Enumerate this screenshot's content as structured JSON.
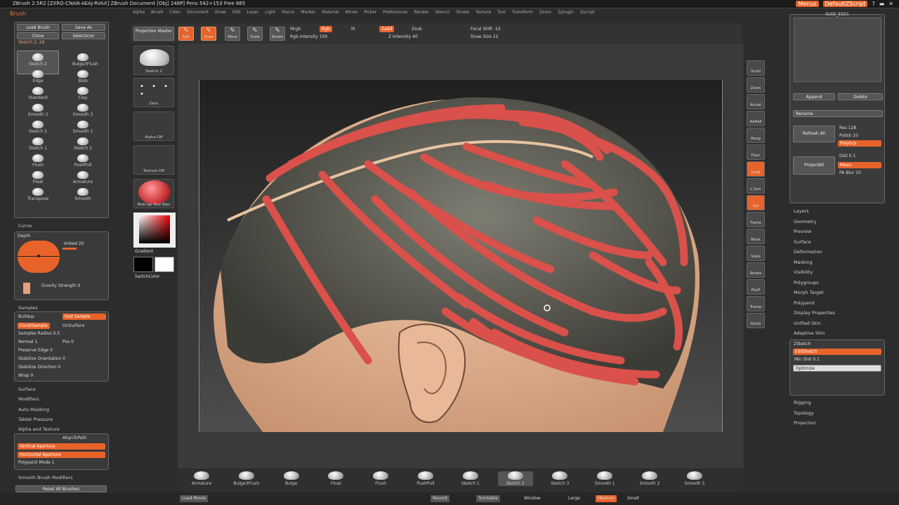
{
  "app": {
    "title": "ZBrush 2.5R2 [ZXRO-CNAN-AEAJ-RVAX]    ZBrush Document    [Obj] 248P] Pens 542+153 Free 885",
    "menus": [
      "Alpha",
      "Brush",
      "Color",
      "Document",
      "Draw",
      "Edit",
      "Layer",
      "Light",
      "Macro",
      "Marker",
      "Material",
      "Movie",
      "Picker",
      "Preferences",
      "Render",
      "Stencil",
      "Stroke",
      "Texture",
      "Tool",
      "Transform",
      "Zoom",
      "Zplugin",
      "Zscript"
    ],
    "menu_highlight": "Menus",
    "default_script": "DefaultZScript",
    "accent": "#e8632a"
  },
  "left": {
    "brush_title": "Brush",
    "load_brush": "Load Brush",
    "save_as": "Save As",
    "clone": "Clone",
    "selection": "SelectIcon",
    "sketch_label": "Sketch 2: 28",
    "brushes": [
      {
        "label": "Sketch 2"
      },
      {
        "label": "Bulge3Flush"
      },
      {
        "label": "Edge"
      },
      {
        "label": "Blob"
      },
      {
        "label": "Standard"
      },
      {
        "label": "Clay"
      },
      {
        "label": "Smooth 2"
      },
      {
        "label": "Smooth 3"
      },
      {
        "label": "Sketch 2"
      },
      {
        "label": "Smooth 1"
      },
      {
        "label": "Sketch 1"
      },
      {
        "label": "Sketch 2"
      },
      {
        "label": "Flush"
      },
      {
        "label": "PushPull"
      },
      {
        "label": "Float"
      },
      {
        "label": "Armature"
      },
      {
        "label": "Transpose"
      },
      {
        "label": "Smooth"
      }
    ],
    "curve": "Curve",
    "depth": "Depth",
    "imbed": "Imbed 20",
    "gravity": "Gravity Strength 0",
    "samples": "Samples",
    "buildup": "Buildup",
    "fast_sample": "Fast Sample",
    "const_sample": "ConstSample",
    "on_surface": "OnSurface",
    "samples_radius": "Samples Radius 0.5",
    "normal": "Normal 1",
    "pos": "Pos 0",
    "preserve_edge": "Preserve Edge 0",
    "stabilize_orientation": "Stabilize Orientation 0",
    "stabilize_direction": "Stabilize Direction 0",
    "wrap": "Wrap 0",
    "surface": "Surface",
    "modifiers": "Modifiers",
    "auto_masking": "Auto Masking",
    "tablet_pressure": "Tablet Pressure",
    "alpha_texture": "Alpha and Texture",
    "align_to_path": "AlignToPath",
    "vertical_aperture": "Vertical Aperture",
    "horizontal_aperture": "Horizontal Aperture",
    "polypaint_mode": "Polypaint Mode 1",
    "smooth_modifiers": "Smooth Brush Modifiers",
    "reset_brushes": "Reset All Brushes"
  },
  "shelf": {
    "projection_master": "Projection Master",
    "tools": [
      "Edit",
      "Draw",
      "Move",
      "Scale",
      "Rotate"
    ],
    "mrgb": "Mrgb",
    "rgb": "Rgb",
    "m": "M",
    "zadd": "Zadd",
    "zsub": "Zsub",
    "rgb_intensity": "Rgb Intensity 100",
    "z_intensity": "Z Intensity 40",
    "focal_shift": "Focal Shift -15",
    "draw_size": "Draw Size 22"
  },
  "tray": {
    "items": [
      "Sketch 2",
      "Dots",
      "Alpha Off",
      "Texture Off",
      "MatCap Red Wax"
    ],
    "gradient": "Gradient",
    "switch_color": "SwitchColor"
  },
  "right_tools": [
    "Scroll",
    "Zoom",
    "Actual",
    "AAHalf",
    "Persp",
    "Floor",
    "Local",
    "L.Sym",
    "Xyz",
    "Frame",
    "Move",
    "Scale",
    "Rotate",
    "PolyF",
    "Transp",
    "Ghost"
  ],
  "right": {
    "subtool_name": "GUIO_ES01",
    "append": "Append",
    "delete": "Delete",
    "rename": "Rename",
    "refresh_all": "Refresh All",
    "project_all": "ProjectAll",
    "res": "Res 128",
    "polish": "Polish 10",
    "polypaint": "PolyGrp",
    "dist": "Dist 0.1",
    "mean": "Mean",
    "pa_blur": "PA Blur 10",
    "sections": [
      "Layers",
      "Geometry",
      "Preview",
      "Surface",
      "Deformation",
      "Masking",
      "Visibility",
      "Polygroups",
      "Morph Target",
      "Polypaint",
      "Display Properties",
      "Unified Skin",
      "Adaptive Skin"
    ],
    "zsketch": "ZSketch",
    "edit_sketch": "EditSketch",
    "min_dist": "Min Dist 0.1",
    "optimize": "Optimize",
    "sections2": [
      "Rigging",
      "Topology",
      "Projection"
    ]
  },
  "bottom": {
    "brushes": [
      "Armature",
      "Bulge3Flush",
      "Bulge",
      "Float",
      "Flush",
      "PushPull",
      "Sketch 1",
      "Sketch 2",
      "Sketch 3",
      "Smooth 1",
      "Smooth 2",
      "Smooth 3"
    ],
    "selected": "Sketch 2",
    "load_movie": "Load Movie",
    "record": "Record",
    "turntable": "Turntable",
    "window": "Window",
    "large": "Large",
    "medium": "Medium",
    "small": "Small"
  }
}
